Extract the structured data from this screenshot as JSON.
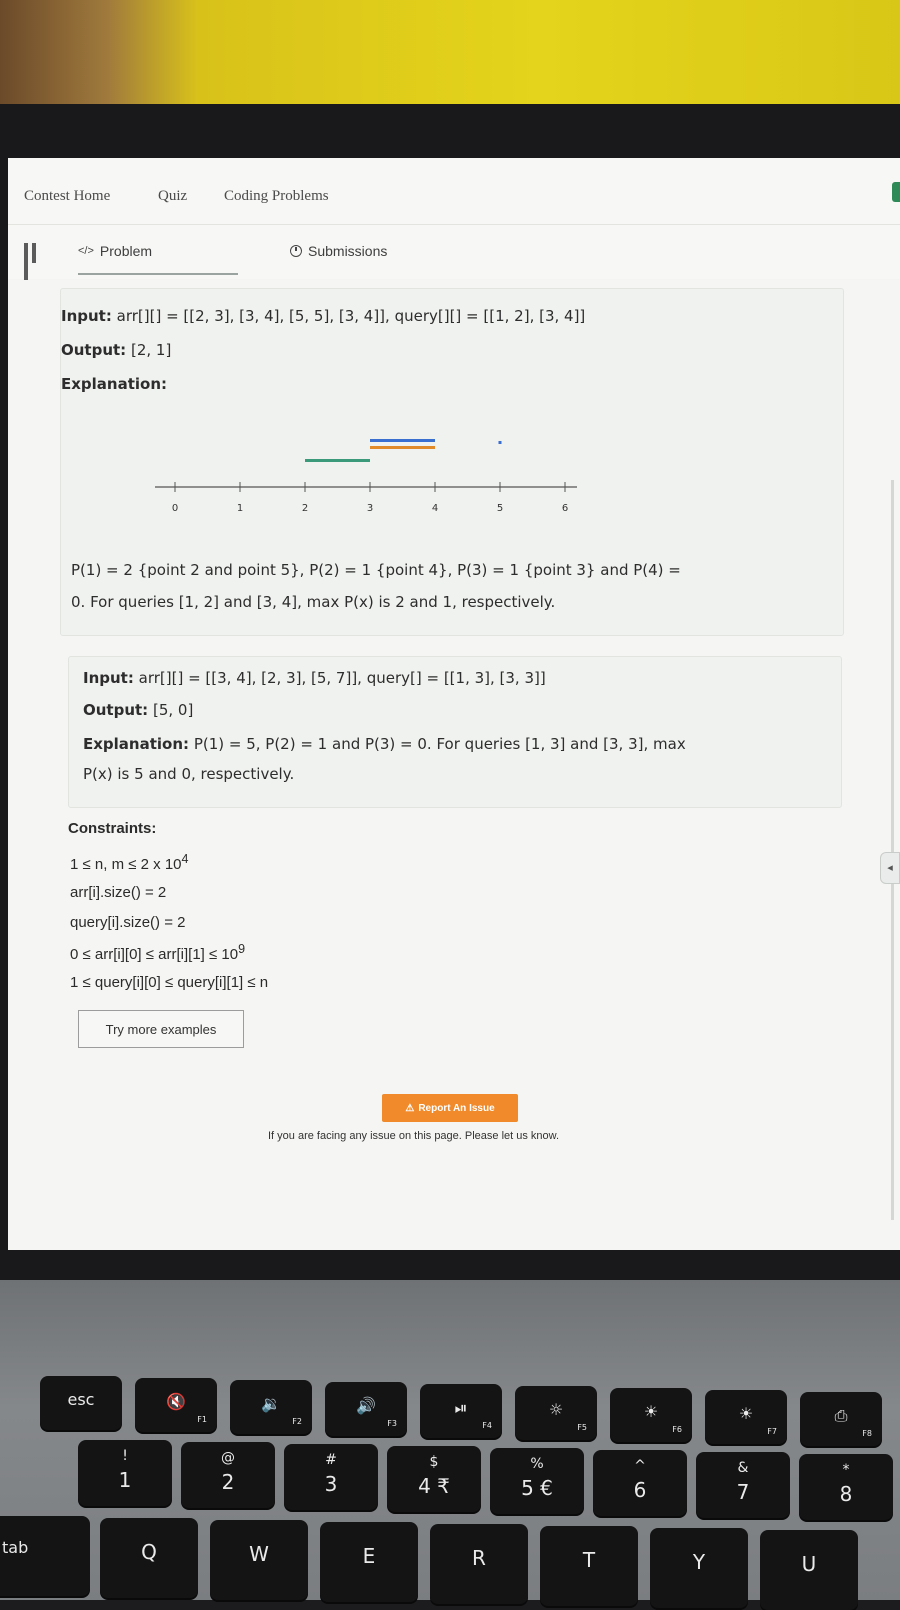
{
  "nav": {
    "contest_home": "Contest Home",
    "quiz": "Quiz",
    "coding_problems": "Coding Problems"
  },
  "tabs": {
    "problem": "Problem",
    "problem_icon": "code-icon",
    "submissions": "Submissions",
    "submissions_icon": "clock-icon"
  },
  "example1": {
    "input_label": "Input:",
    "input_text": "arr[][] = [[2, 3], [3, 4], [5, 5], [3, 4]], query[][] = [[1, 2], [3, 4]]",
    "output_label": "Output:",
    "output_text": "[2, 1]",
    "explanation_label": "Explanation:",
    "axis_ticks": [
      "0",
      "1",
      "2",
      "3",
      "4",
      "5",
      "6"
    ],
    "segments": [
      {
        "from": 2,
        "to": 3,
        "color": "#3a9a7a"
      },
      {
        "from": 3,
        "to": 4,
        "color": "#3a6fd0"
      },
      {
        "from": 3,
        "to": 4,
        "color": "#e08a2a"
      },
      {
        "from": 5,
        "to": 5,
        "color": "#3a6fd0"
      }
    ],
    "note_line1": "P(1) = 2 {point 2 and point 5}, P(2) = 1 {point 4}, P(3) = 1 {point 3} and P(4) =",
    "note_line2": "0. For queries [1, 2] and [3, 4], max P(x) is 2 and 1, respectively."
  },
  "example2": {
    "input_label": "Input:",
    "input_text": "arr[][] = [[3, 4], [2, 3], [5, 7]], query[] = [[1, 3], [3, 3]]",
    "output_label": "Output:",
    "output_text": "[5, 0]",
    "explanation_label": "Explanation:",
    "explanation_line1": "P(1) = 5, P(2) = 1 and P(3) = 0. For queries [1, 3] and [3, 3], max",
    "explanation_line2": "P(x) is 5 and 0, respectively."
  },
  "constraints": {
    "title": "Constraints:",
    "c1_base": "1 ≤ n, m ≤ 2 x 10",
    "c1_exp": "4",
    "c2": "arr[i].size() = 2",
    "c3": "query[i].size() = 2",
    "c4_base": "0 ≤ arr[i][0] ≤ arr[i][1] ≤ 10",
    "c4_exp": "9",
    "c5": "1 ≤ query[i][0] ≤ query[i][1] ≤ n"
  },
  "try_more": "Try more examples",
  "report": {
    "label": "Report An Issue",
    "note": "If you are facing any issue on this page. Please let us know."
  },
  "keyboard": {
    "row1": [
      {
        "main": "esc",
        "fn": ""
      },
      {
        "main": "🔇",
        "fn": "F1"
      },
      {
        "main": "🔉",
        "fn": "F2"
      },
      {
        "main": "🔊",
        "fn": "F3"
      },
      {
        "main": "⏯",
        "fn": "F4"
      },
      {
        "main": "☼",
        "fn": "F5"
      },
      {
        "main": "☀",
        "fn": "F6"
      },
      {
        "main": "☀",
        "fn": "F7"
      },
      {
        "main": "⎙",
        "fn": "F8"
      }
    ],
    "row2": [
      {
        "top": "!",
        "main": "1"
      },
      {
        "top": "@",
        "main": "2"
      },
      {
        "top": "#",
        "main": "3"
      },
      {
        "top": "$",
        "main": "4 ₹"
      },
      {
        "top": "%",
        "main": "5 €"
      },
      {
        "top": "^",
        "main": "6"
      },
      {
        "top": "&",
        "main": "7"
      },
      {
        "top": "*",
        "main": "8"
      }
    ],
    "row3": [
      "tab",
      "Q",
      "W",
      "E",
      "R",
      "T",
      "Y",
      "U"
    ]
  }
}
